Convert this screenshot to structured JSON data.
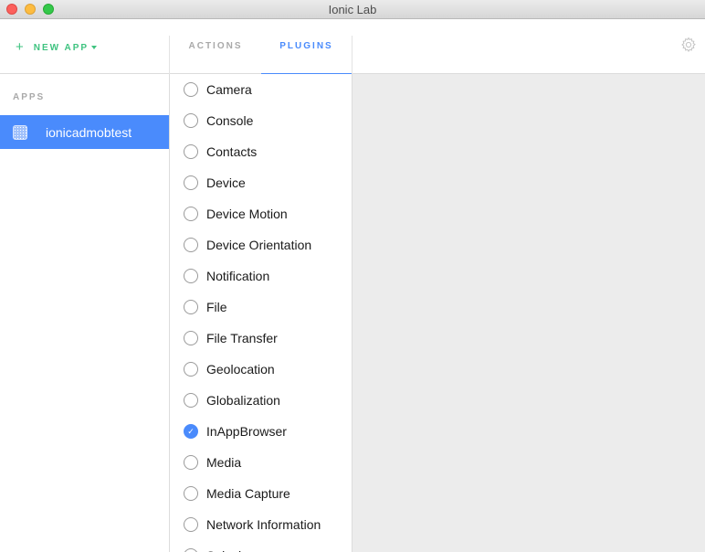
{
  "window": {
    "title": "Ionic Lab"
  },
  "header": {
    "new_app_label": "NEW APP",
    "tabs": [
      {
        "label": "ACTIONS",
        "active": false
      },
      {
        "label": "PLUGINS",
        "active": true
      }
    ]
  },
  "sidebar": {
    "section_label": "APPS",
    "apps": [
      {
        "name": "ionicadmobtest",
        "selected": true
      }
    ]
  },
  "plugins": [
    {
      "label": "Camera",
      "checked": false
    },
    {
      "label": "Console",
      "checked": false
    },
    {
      "label": "Contacts",
      "checked": false
    },
    {
      "label": "Device",
      "checked": false
    },
    {
      "label": "Device Motion",
      "checked": false
    },
    {
      "label": "Device Orientation",
      "checked": false
    },
    {
      "label": "Notification",
      "checked": false
    },
    {
      "label": "File",
      "checked": false
    },
    {
      "label": "File Transfer",
      "checked": false
    },
    {
      "label": "Geolocation",
      "checked": false
    },
    {
      "label": "Globalization",
      "checked": false
    },
    {
      "label": "InAppBrowser",
      "checked": true
    },
    {
      "label": "Media",
      "checked": false
    },
    {
      "label": "Media Capture",
      "checked": false
    },
    {
      "label": "Network Information",
      "checked": false
    },
    {
      "label": "Splash",
      "checked": false
    }
  ],
  "colors": {
    "accent": "#4a8bfc",
    "new_app": "#3fc380"
  },
  "icons": {
    "plus": "+",
    "check": "✓",
    "settings": "gear-icon"
  }
}
